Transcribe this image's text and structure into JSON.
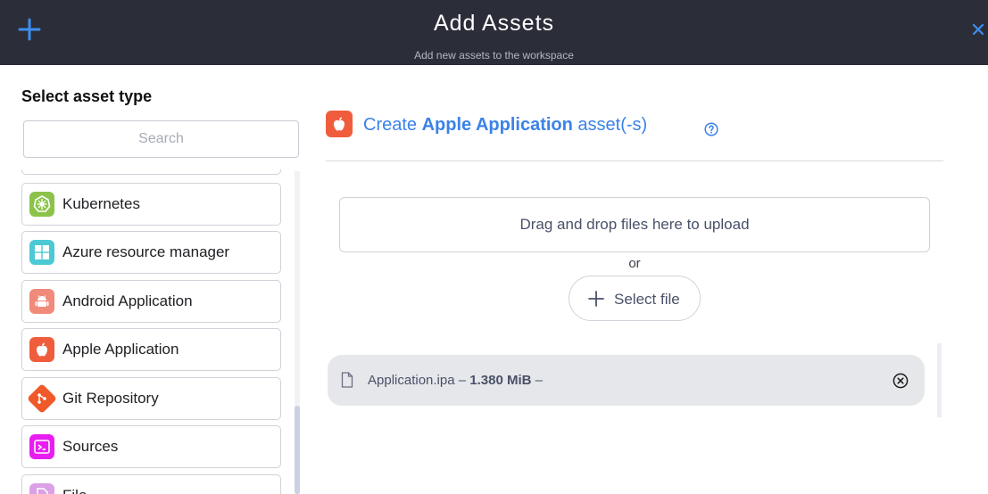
{
  "header": {
    "title": "Add Assets",
    "subtitle": "Add new assets to the workspace",
    "accent": "#3b8ff0"
  },
  "sidebar": {
    "heading": "Select asset type",
    "search_placeholder": "Search",
    "items": [
      {
        "label": "",
        "icon": "partial-icon",
        "color": "#e8e8ee"
      },
      {
        "label": "Kubernetes",
        "icon": "kubernetes-icon",
        "color": "#8bc34a"
      },
      {
        "label": "Azure resource manager",
        "icon": "windows-icon",
        "color": "#4cc9d4"
      },
      {
        "label": "Android Application",
        "icon": "android-icon",
        "color": "#f08a7a"
      },
      {
        "label": "Apple Application",
        "icon": "apple-icon",
        "color": "#f05d3c"
      },
      {
        "label": "Git Repository",
        "icon": "git-icon",
        "color": "#f0592a"
      },
      {
        "label": "Sources",
        "icon": "terminal-icon",
        "color": "#e81ef0"
      },
      {
        "label": "File",
        "icon": "file-icon",
        "color": "#dba0e6"
      }
    ]
  },
  "main": {
    "create_prefix": "Create",
    "create_type": "Apple Application",
    "create_suffix": "asset(-s)",
    "dropzone_text": "Drag and drop files here to upload",
    "or_text": "or",
    "select_file_label": "Select file",
    "file": {
      "name": "Application.ipa",
      "separator1": "–",
      "size": "1.380 MiB",
      "separator2": "–"
    }
  }
}
